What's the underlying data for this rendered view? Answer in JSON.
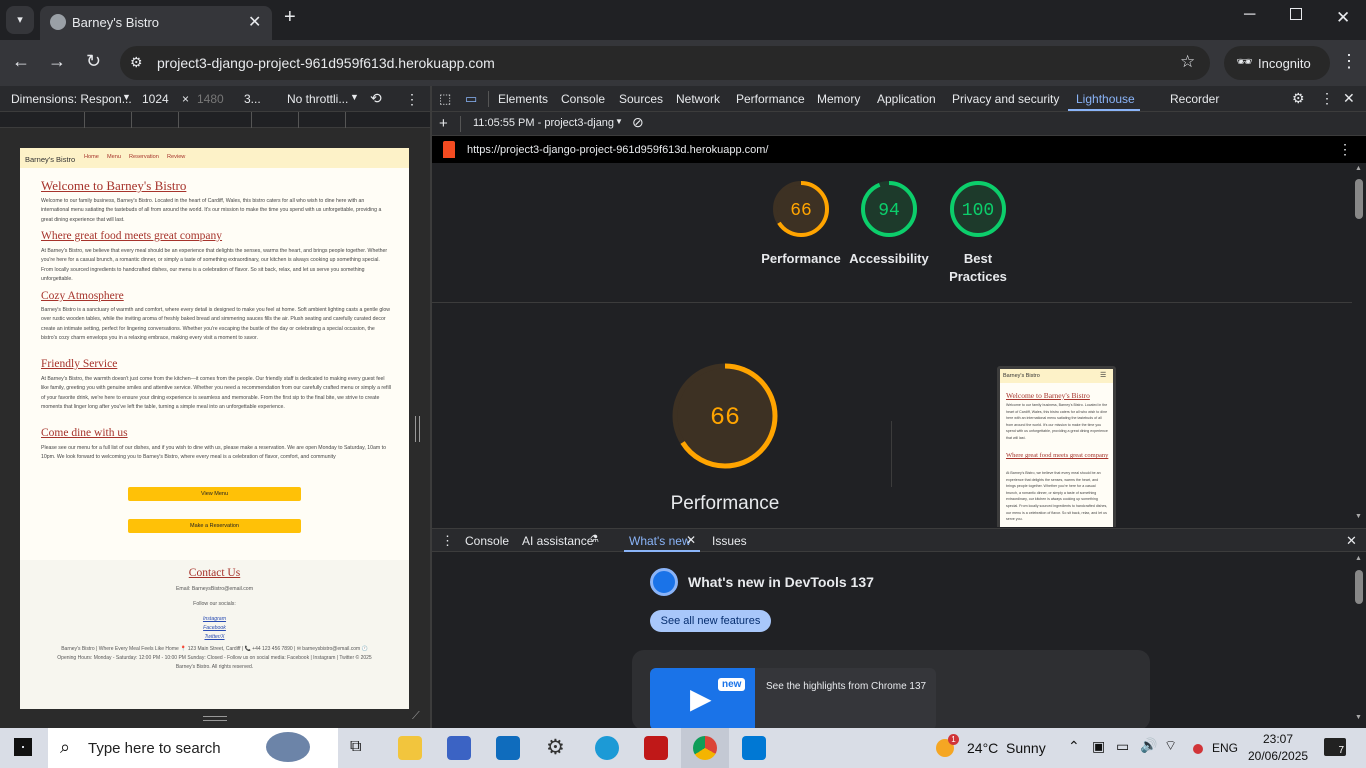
{
  "browser": {
    "tab_title": "Barney's Bistro",
    "url": "project3-django-project-961d959f613d.herokuapp.com",
    "incognito_label": "Incognito"
  },
  "device_toolbar": {
    "dimensions": "Dimensions: Respon...",
    "width": "1024",
    "height": "1480",
    "dpr": "3...",
    "throttle": "No throttli..."
  },
  "site": {
    "brand": "Barney's Bistro",
    "nav": [
      "Home",
      "Menu",
      "Reservation",
      "Review"
    ],
    "sections": [
      {
        "title": "Welcome to Barney's Bistro",
        "text": "Welcome to our family business, Barney's Bistro. Located in the heart of Cardiff, Wales, this bistro caters for all who wish to dine here with an international menu satiating the tastebuds of all from around the world. It's our mission to make the time you spend with us unforgettable, providing a great dining experience that will last."
      },
      {
        "title": "Where great food meets great company",
        "text": "At Barney's Bistro, we believe that every meal should be an experience that delights the senses, warms the heart, and brings people together. Whether you're here for a casual brunch, a romantic dinner, or simply a taste of something extraordinary, our kitchen is always cooking up something special. From locally sourced ingredients to handcrafted dishes, our menu is a celebration of flavor. So sit back, relax, and let us serve you something unforgettable."
      },
      {
        "title": "Cozy Atmosphere",
        "text": "Barney's Bistro is a sanctuary of warmth and comfort, where every detail is designed to make you feel at home. Soft ambient lighting casts a gentle glow over rustic wooden tables, while the inviting aroma of freshly baked bread and simmering sauces fills the air. Plush seating and carefully curated decor create an intimate setting, perfect for lingering conversations. Whether you're escaping the bustle of the day or celebrating a special occasion, the bistro's cozy charm envelops you in a relaxing embrace, making every visit a moment to savor."
      },
      {
        "title": "Friendly Service",
        "text": "At Barney's Bistro, the warmth doesn't just come from the kitchen—it comes from the people. Our friendly staff is dedicated to making every guest feel like family, greeting you with genuine smiles and attentive service. Whether you need a recommendation from our carefully crafted menu or simply a refill of your favorite drink, we're here to ensure your dining experience is seamless and memorable. From the first sip to the final bite, we strive to create moments that linger long after you've left the table, turning a simple meal into an unforgettable experience."
      },
      {
        "title": "Come dine with us",
        "text": "Please see our menu for a full list of our dishes, and if you wish to dine with us, please make a reservation. We are open Monday to Saturday, 10am to 10pm. We look forward to welcoming you to Barney's Bistro, where every meal is a celebration of flavor, comfort, and community"
      }
    ],
    "btn_menu": "View Menu",
    "btn_reserve": "Make a Reservation",
    "contact_title": "Contact Us",
    "contact_email": "Email: BarneysBistro@email.com",
    "follow": "Follow our socials:",
    "socials": [
      "Instagram",
      "Facebook",
      "Twitter/X"
    ],
    "footer1": "Barney's Bistro | Where Every Meal Feels Like Home 📍 123 Main Street, Cardiff | 📞 +44 123 456 7890 | ✉ barneysbistro@email.com 🕐",
    "footer2": "Opening Hours: Monday - Saturday: 12:00 PM - 10:00 PM Sunday: Closed - Follow us on social media: Facebook | Instagram | Twitter © 2025",
    "footer3": "Barney's Bistro. All rights reserved."
  },
  "devtools": {
    "tabs": [
      "Elements",
      "Console",
      "Sources",
      "Network",
      "Performance",
      "Memory",
      "Application",
      "Privacy and security",
      "Lighthouse",
      "Recorder"
    ],
    "active_tab": "Lighthouse",
    "report_select": "11:05:55 PM - project3-djang",
    "report_url": "https://project3-django-project-961d959f613d.herokuapp.com/",
    "scores": [
      {
        "label": "Performance",
        "value": "66",
        "fraction": 0.66,
        "color": "#ffa400",
        "track": "#3d3123"
      },
      {
        "label": "Accessibility",
        "value": "94",
        "fraction": 0.94,
        "color": "#0cce6b",
        "track": "#1d3a2b"
      },
      {
        "label": "Best Practices",
        "value": "100",
        "fraction": 1.0,
        "color": "#0cce6b",
        "track": "#1d3a2b"
      }
    ],
    "big_score": {
      "value": "66",
      "label": "Performance",
      "fraction": 0.66
    },
    "thumb": {
      "brand": "Barney's Bistro",
      "h1": "Welcome to Barney's Bistro",
      "p1": "Welcome to our family business, Barney's Bistro. Located in the heart of Cardiff, Wales, this bistro caters for all who wish to dine here with an international menu satiating the tastebuds of all from around the world. It's our mission to make the time you spend with us unforgettable, providing a great dining experience that will last.",
      "h2": "Where great food meets great company",
      "p2": "At Barney's Bistro, we believe that every meal should be an experience that delights the senses, warms the heart, and brings people together. Whether you're here for a casual brunch, a romantic dinner, or simply a taste of something extraordinary, our kitchen is always cooking up something special. From locally sourced ingredients to handcrafted dishes, our menu is a celebration of flavor. So sit back, relax, and let us serve you."
    },
    "drawer_tabs": [
      "Console",
      "AI assistance",
      "What's new",
      "Issues"
    ],
    "whats_new_title": "What's new in DevTools 137",
    "see_all": "See all new features",
    "highlight_badge": "new",
    "highlight_text": "See the highlights from Chrome 137"
  },
  "taskbar": {
    "search_placeholder": "Type here to search",
    "weather_temp": "24°C",
    "weather_desc": "Sunny",
    "weather_badge": "1",
    "lang": "ENG",
    "time": "23:07",
    "date": "20/06/2025",
    "notif_count": "7"
  }
}
